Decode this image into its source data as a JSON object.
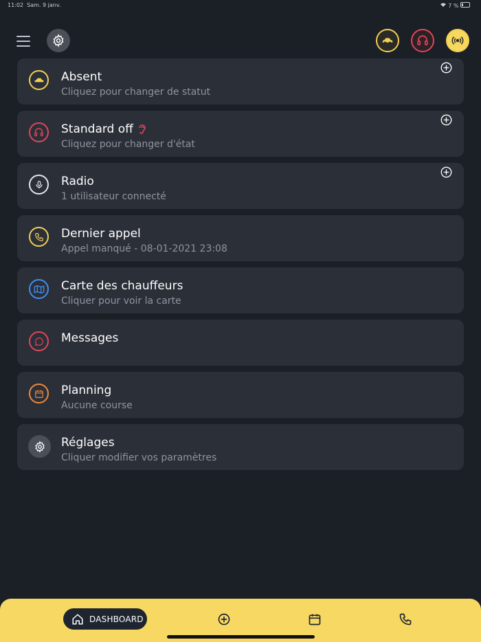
{
  "status_bar": {
    "time": "11:02",
    "date": "Sam. 9 janv.",
    "battery": "7 %"
  },
  "header": {
    "menu_icon": "hamburger-icon",
    "settings_icon": "gear-icon",
    "status_buttons": [
      {
        "name": "car-status",
        "icon": "car-icon",
        "color": "#f2cf55"
      },
      {
        "name": "headset-status",
        "icon": "headset-icon",
        "color": "#e0455b"
      },
      {
        "name": "radio-status",
        "icon": "broadcast-icon",
        "color": "#f2cf55"
      }
    ]
  },
  "cards": [
    {
      "title": "Absent",
      "subtitle": "Cliquez pour changer de statut",
      "icon": "car-icon",
      "color": "#f2cf55",
      "has_plus": true
    },
    {
      "title": "Standard off",
      "subtitle": "Cliquez pour changer d'état",
      "icon": "headset-icon",
      "color": "#e0455b",
      "has_plus": true
    },
    {
      "title": "Radio",
      "subtitle": "1 utilisateur connecté",
      "icon": "microphone-icon",
      "color": "#e6e6e6",
      "has_plus": true
    },
    {
      "title": "Dernier appel",
      "subtitle": "Appel manqué - 08-01-2021 23:08",
      "icon": "phone-icon",
      "color": "#f2cf55",
      "has_plus": false
    },
    {
      "title": "Carte des chauffeurs",
      "subtitle": "Cliquer pour voir la carte",
      "icon": "map-icon",
      "color": "#3f8ef0",
      "has_plus": false
    },
    {
      "title": "Messages",
      "subtitle": "",
      "icon": "chat-bubble-icon",
      "color": "#e0455b",
      "has_plus": false
    },
    {
      "title": "Planning",
      "subtitle": "Aucune course",
      "icon": "calendar-icon",
      "color": "#ee8a3c",
      "has_plus": false
    },
    {
      "title": "Réglages",
      "subtitle": "Cliquer modifier vos paramètres",
      "icon": "gear-icon",
      "color": "#4a4f58",
      "has_plus": false
    }
  ],
  "bottom_nav": {
    "dashboard_label": "DASHBOARD",
    "items": [
      "home-icon",
      "add-circle-icon",
      "calendar-icon",
      "phone-icon"
    ]
  },
  "colors": {
    "background": "#1b1f26",
    "card": "#2b2f38",
    "accent": "#f7d862"
  }
}
